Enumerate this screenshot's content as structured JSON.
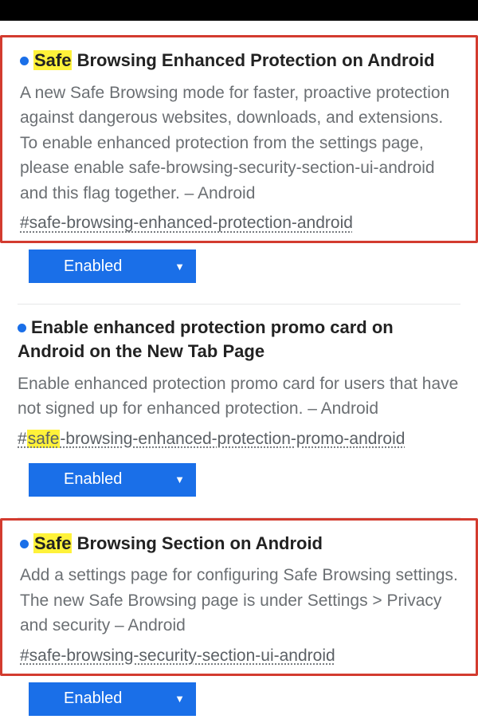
{
  "select_value": "Enabled",
  "flags": [
    {
      "title_pre_highlight": "",
      "title_highlight": "Safe",
      "title_post_highlight": " Browsing Enhanced Protection on Android",
      "description": "A new Safe Browsing mode for faster, proactive protection against dangerous websites, downloads, and extensions. To enable enhanced protection from the settings page, please enable safe-browsing-security-section-ui-android and this flag together. – Android",
      "anchor_pre_highlight": "#safe-browsing-enhanced-protection-android",
      "anchor_highlight": "",
      "anchor_post_highlight": "",
      "boxed": true
    },
    {
      "title_pre_highlight": "Enable enhanced protection promo card on Android on the New Tab Page",
      "title_highlight": "",
      "title_post_highlight": "",
      "description": "Enable enhanced protection promo card for users that have not signed up for enhanced protection. – Android",
      "anchor_pre_highlight": "#",
      "anchor_highlight": "safe",
      "anchor_post_highlight": "-browsing-enhanced-protection-promo-android",
      "boxed": false
    },
    {
      "title_pre_highlight": "",
      "title_highlight": "Safe",
      "title_post_highlight": " Browsing Section on Android",
      "description": "Add a settings page for configuring Safe Browsing settings. The new Safe Browsing page is under Settings > Privacy and security – Android",
      "anchor_pre_highlight": "#safe-browsing-security-section-ui-android",
      "anchor_highlight": "",
      "anchor_post_highlight": "",
      "boxed": true
    }
  ]
}
